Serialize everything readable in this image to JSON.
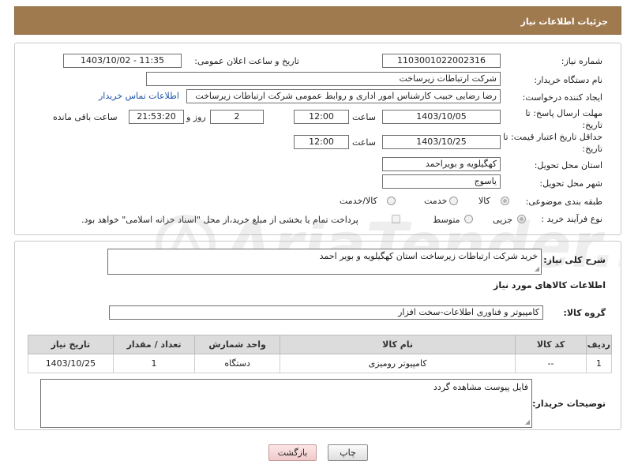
{
  "header": {
    "title": "جزئیات اطلاعات نیاز"
  },
  "form": {
    "need_number_label": "شماره نیاز:",
    "need_number": "1103001022002316",
    "announce_label": "تاریخ و ساعت اعلان عمومی:",
    "announce_value": "1403/10/02 - 11:35",
    "buyer_org_label": "نام دستگاه خریدار:",
    "buyer_org": "شرکت ارتباطات زیرساخت",
    "creator_label": "ایجاد کننده درخواست:",
    "creator": "رضا رضایی حبیب کارشناس امور اداری و روابط عمومی شرکت ارتباطات زیرساخت",
    "contact_link": "اطلاعات تماس خریدار",
    "deadline_label_1": "مهلت ارسال پاسخ: تا",
    "deadline_label_2": "تاریخ:",
    "deadline_date": "1403/10/05",
    "time_label": "ساعت",
    "deadline_time": "12:00",
    "days_count": "2",
    "days_label": "روز و",
    "remaining_time": "21:53:20",
    "remaining_label": "ساعت باقی مانده",
    "price_validity_label_1": "حداقل تاریخ اعتبار قیمت: تا",
    "price_validity_label_2": "تاریخ:",
    "price_validity_date": "1403/10/25",
    "price_validity_time": "12:00",
    "province_label": "استان محل تحویل:",
    "province": "کهگیلویه و بویراحمد",
    "city_label": "شهر محل تحویل:",
    "city": "یاسوج",
    "category_label": "طبقه بندی موضوعی:",
    "category_options": [
      "کالا",
      "خدمت",
      "کالا/خدمت"
    ],
    "category_selected": "کالا",
    "purchase_type_label": "نوع فرآیند خرید :",
    "purchase_options": [
      "جزیی",
      "متوسط"
    ],
    "purchase_selected": "جزیی",
    "payment_note": "پرداخت تمام یا بخشی از مبلغ خرید،از محل \"اسناد خزانه اسلامی\" خواهد بود."
  },
  "details": {
    "description_label": "شرح کلی نیاز:",
    "description": "خرید شرکت ارتباطات زیرساخت استان کهگیلویه و بویر احمد",
    "goods_info_title": "اطلاعات کالاهای مورد نیاز",
    "goods_group_label": "گروه کالا:",
    "goods_group": "کامپیوتر و فناوری اطلاعات-سخت افزار",
    "table": {
      "headers": [
        "ردیف",
        "کد کالا",
        "نام کالا",
        "واحد شمارش",
        "تعداد / مقدار",
        "تاریخ نیاز"
      ],
      "rows": [
        [
          "1",
          "--",
          "کامپیوتر رومیزی",
          "دستگاه",
          "1",
          "1403/10/25"
        ]
      ]
    },
    "buyer_notes_label": "توضیحات خریدار:",
    "buyer_notes": "فایل پیوست مشاهده گردد"
  },
  "buttons": {
    "print": "چاپ",
    "back": "بازگشت"
  },
  "watermark": {
    "text": "AriaTender.neT"
  },
  "colors": {
    "header_bg": "#9f7a4e",
    "link": "#1e53a8",
    "back_button_bg": "#f6dada"
  }
}
